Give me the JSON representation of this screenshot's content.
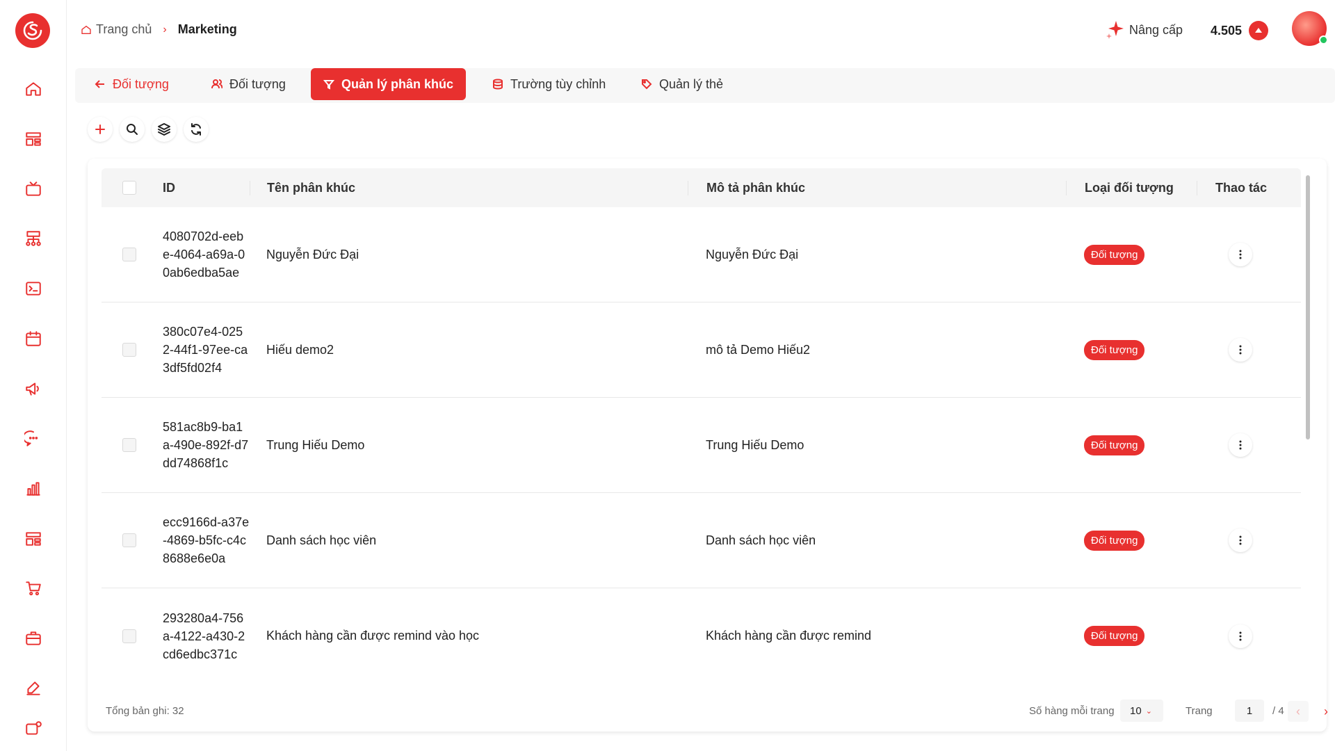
{
  "breadcrumb": {
    "home": "Trang chủ",
    "current": "Marketing"
  },
  "header": {
    "upgrade_label": "Nâng cấp",
    "credits": "4.505"
  },
  "tabs": [
    {
      "label": "Đối tượng",
      "icon": "arrow-left-icon"
    },
    {
      "label": "Đối tượng",
      "icon": "users-icon"
    },
    {
      "label": "Quản lý phân khúc",
      "icon": "funnel-icon"
    },
    {
      "label": "Trường tùy chỉnh",
      "icon": "database-icon"
    },
    {
      "label": "Quản lý thẻ",
      "icon": "tag-icon"
    }
  ],
  "table": {
    "columns": {
      "id": "ID",
      "name": "Tên phân khúc",
      "desc": "Mô tả phân khúc",
      "type": "Loại đối tượng",
      "action": "Thao tác"
    },
    "rows": [
      {
        "id": "4080702d-eebe-4064-a69a-00ab6edba5ae",
        "name": "Nguyễn Đức Đại",
        "desc": "Nguyễn Đức Đại",
        "type": "Đối tượng"
      },
      {
        "id": "380c07e4-0252-44f1-97ee-ca3df5fd02f4",
        "name": "Hiếu demo2",
        "desc": "mô tả Demo Hiếu2",
        "type": "Đối tượng"
      },
      {
        "id": "581ac8b9-ba1a-490e-892f-d7dd74868f1c",
        "name": "Trung Hiếu Demo",
        "desc": "Trung Hiếu Demo",
        "type": "Đối tượng"
      },
      {
        "id": "ecc9166d-a37e-4869-b5fc-c4c8688e6e0a",
        "name": "Danh sách học viên",
        "desc": "Danh sách học viên",
        "type": "Đối tượng"
      },
      {
        "id": "293280a4-756a-4122-a430-2cd6edbc371c",
        "name": "Khách hàng cần được remind vào học",
        "desc": "Khách hàng cần được remind",
        "type": "Đối tượng"
      }
    ]
  },
  "footer": {
    "total": "Tổng bản ghi: 32",
    "per_page_label": "Số hàng mỗi trang",
    "per_page_value": "10",
    "page_label": "Trang",
    "page_current": "1",
    "page_total": "/ 4"
  },
  "colors": {
    "accent": "#e8302f",
    "online": "#22c55e"
  }
}
